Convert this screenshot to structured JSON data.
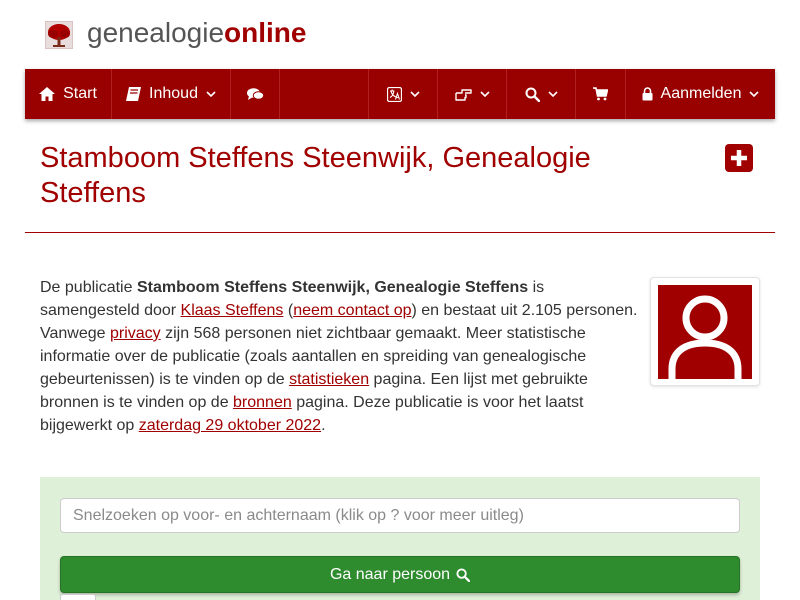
{
  "brand": {
    "prefix": "genealogie",
    "suffix": "online",
    "logo_icon": "tree-icon"
  },
  "nav": {
    "start_label": "Start",
    "inhoud_label": "Inhoud",
    "login_label": "Aanmelden",
    "icons": [
      "home-icon",
      "book-icon",
      "chat-icon",
      "language-icon",
      "hand-point-icon",
      "search-icon",
      "cart-icon",
      "lock-icon"
    ]
  },
  "page": {
    "title": "Stamboom Steffens Steenwijk, Genealogie Steffens"
  },
  "intro": {
    "t1": "De publicatie ",
    "pub_name": "Stamboom Steffens Steenwijk, Genealogie Steffens",
    "t2": " is samengesteld door ",
    "author_link": "Klaas Steffens",
    "t3": " (",
    "contact_link": "neem contact op",
    "t4": ") en bestaat uit 2.105 personen. Vanwege ",
    "privacy_link": "privacy",
    "t5": " zijn 568 personen niet zichtbaar gemaakt. Meer statistische informatie over de publicatie (zoals aantallen en spreiding van genealogische gebeurtenissen) is te vinden op de ",
    "stats_link": "statistieken",
    "t6": " pagina. Een lijst met gebruikte bronnen is te vinden op de ",
    "sources_link": "bronnen",
    "t7": " pagina. Deze publicatie is voor het laatst bijgewerkt op ",
    "date_link": "zaterdag 29 oktober 2022",
    "t8": "."
  },
  "search": {
    "placeholder": "Snelzoeken op voor- en achternaam (klik op ? voor meer uitleg)",
    "button_label": "Ga naar persoon"
  },
  "colors": {
    "brand_red": "#990000",
    "link_red": "#a00000",
    "panel_green": "#dff0d8",
    "button_green": "#2e8b2e"
  }
}
